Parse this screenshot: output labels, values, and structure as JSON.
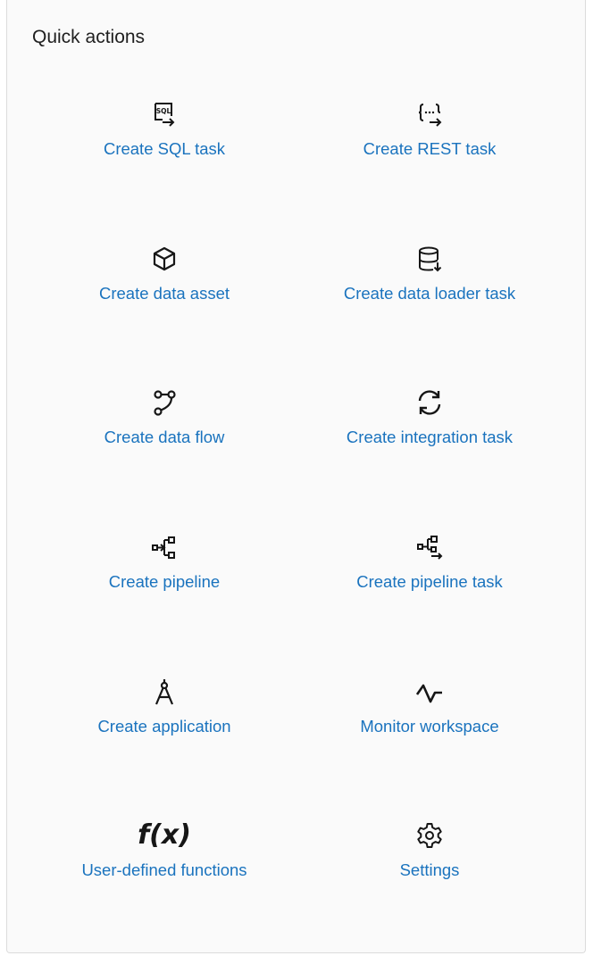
{
  "panel": {
    "title": "Quick actions"
  },
  "actions": [
    {
      "id": "create-sql-task",
      "label": "Create SQL task",
      "icon": "sql-icon"
    },
    {
      "id": "create-rest-task",
      "label": "Create REST task",
      "icon": "rest-icon"
    },
    {
      "id": "create-data-asset",
      "label": "Create data asset",
      "icon": "cube-icon"
    },
    {
      "id": "create-data-loader-task",
      "label": "Create data loader task",
      "icon": "database-download-icon"
    },
    {
      "id": "create-data-flow",
      "label": "Create data flow",
      "icon": "data-flow-icon"
    },
    {
      "id": "create-integration-task",
      "label": "Create integration task",
      "icon": "refresh-icon"
    },
    {
      "id": "create-pipeline",
      "label": "Create pipeline",
      "icon": "pipeline-icon"
    },
    {
      "id": "create-pipeline-task",
      "label": "Create pipeline task",
      "icon": "pipeline-task-icon"
    },
    {
      "id": "create-application",
      "label": "Create application",
      "icon": "compass-icon"
    },
    {
      "id": "monitor-workspace",
      "label": "Monitor workspace",
      "icon": "pulse-icon"
    },
    {
      "id": "user-defined-functions",
      "label": "User-defined functions",
      "icon": "function-icon",
      "icon_text": "f(x)"
    },
    {
      "id": "settings",
      "label": "Settings",
      "icon": "gear-icon"
    }
  ],
  "colors": {
    "link": "#1a73be",
    "icon": "#161616",
    "panel_bg": "#fafafa",
    "border": "#dcdcdc"
  }
}
